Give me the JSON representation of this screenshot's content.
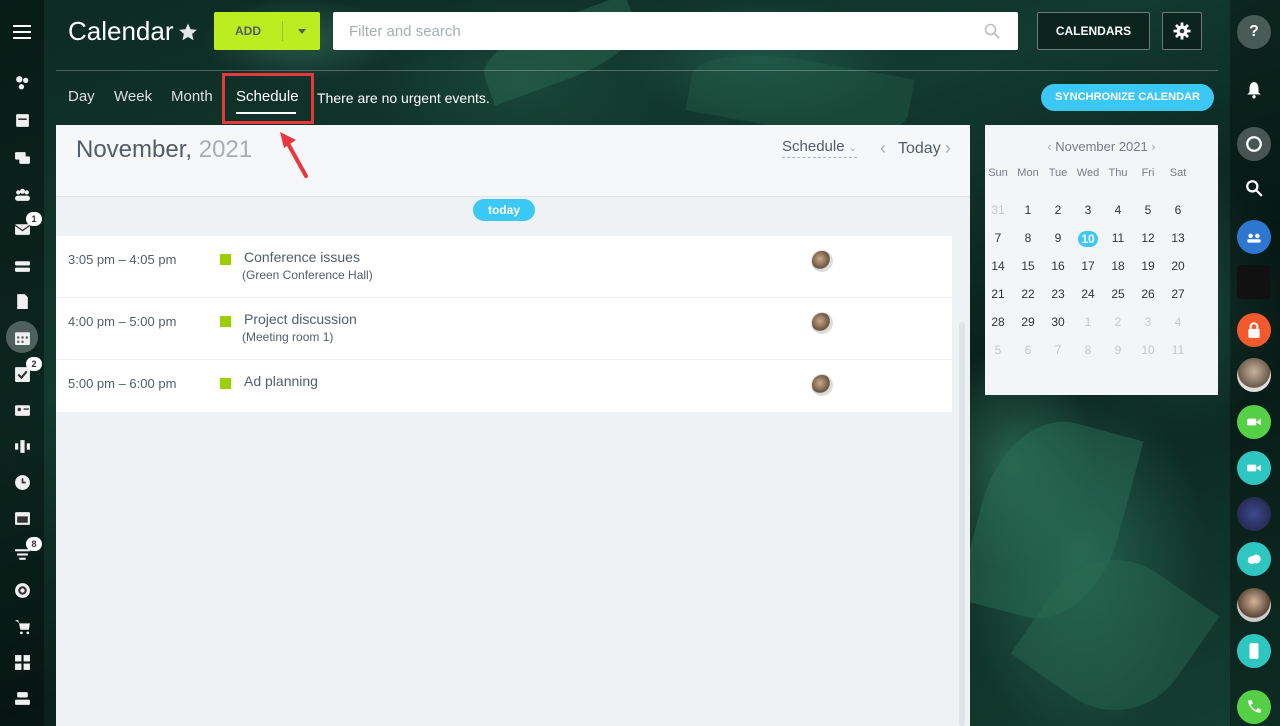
{
  "header": {
    "title": "Calendar",
    "add_label": "ADD",
    "search_placeholder": "Filter and search",
    "calendars_label": "CALENDARS"
  },
  "left_sidebar": {
    "badges": {
      "mail": "1",
      "tasks": "2",
      "feed": "8"
    }
  },
  "tabs": [
    {
      "label": "Day"
    },
    {
      "label": "Week"
    },
    {
      "label": "Month"
    },
    {
      "label": "Schedule",
      "active": true
    }
  ],
  "urgent_text": "There are no urgent events.",
  "sync_label": "SYNCHRONIZE CALENDAR",
  "main": {
    "month": "November,",
    "year": "2021",
    "view_select": "Schedule",
    "today_nav": "Today",
    "today_pill": "today",
    "events": [
      {
        "time": "3:05 pm – 4:05 pm",
        "name": "Conference issues",
        "location": "(Green Conference Hall)"
      },
      {
        "time": "4:00 pm – 5:00 pm",
        "name": "Project discussion",
        "location": "(Meeting room 1)"
      },
      {
        "time": "5:00 pm – 6:00 pm",
        "name": "Ad planning",
        "location": ""
      }
    ]
  },
  "mini_calendar": {
    "title": "November 2021",
    "weekdays": [
      "Sun",
      "Mon",
      "Tue",
      "Wed",
      "Thu",
      "Fri",
      "Sat"
    ],
    "weeks": [
      [
        "31",
        "1",
        "2",
        "3",
        "4",
        "5",
        "6"
      ],
      [
        "7",
        "8",
        "9",
        "10",
        "11",
        "12",
        "13"
      ],
      [
        "14",
        "15",
        "16",
        "17",
        "18",
        "19",
        "20"
      ],
      [
        "21",
        "22",
        "23",
        "24",
        "25",
        "26",
        "27"
      ],
      [
        "28",
        "29",
        "30",
        "1",
        "2",
        "3",
        "4"
      ],
      [
        "5",
        "6",
        "7",
        "8",
        "9",
        "10",
        "11"
      ]
    ],
    "today": "10"
  },
  "colors": {
    "accent_green": "#bbed21",
    "accent_blue": "#3bc8f5",
    "event_dot": "#9dcf00",
    "highlight_red": "#e8373f"
  }
}
